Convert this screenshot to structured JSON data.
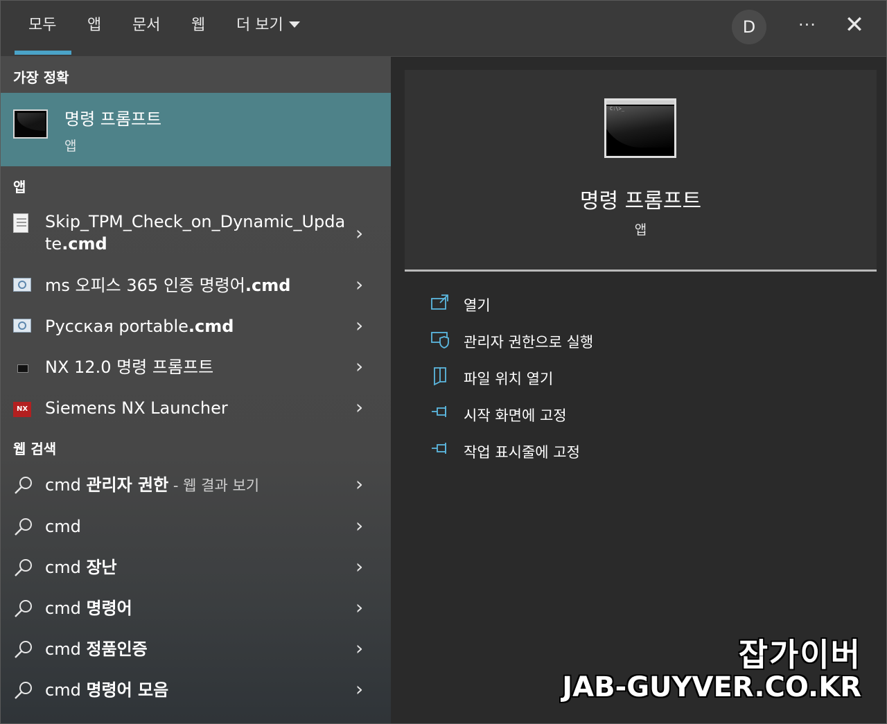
{
  "tabs": [
    {
      "label": "모두"
    },
    {
      "label": "앱"
    },
    {
      "label": "문서"
    },
    {
      "label": "웹"
    },
    {
      "label": "더 보기"
    }
  ],
  "account": {
    "initial": "D"
  },
  "more_label": "···",
  "close_label": "✕",
  "left": {
    "best_match_header": "가장 정확",
    "best_match": {
      "title": "명령 프롬프트",
      "subtitle": "앱"
    },
    "apps_header": "앱",
    "apps": [
      {
        "line1": "Skip_TPM_Check_on_Dynamic_Upda",
        "line2_pre": "te",
        "line2_bold": ".cmd",
        "icon": "document-icon"
      },
      {
        "text": "ms 오피스 365 인증 명령어",
        "bold": ".cmd",
        "icon": "settings-document-icon"
      },
      {
        "text": "Русская portable",
        "bold": ".cmd",
        "icon": "settings-document-icon"
      },
      {
        "text": "NX 12.0 명령 프롬프트",
        "icon": "command-prompt-icon"
      },
      {
        "text": "Siemens NX Launcher",
        "icon": "nx-logo-icon",
        "icon_text": "NX"
      }
    ],
    "web_header": "웹 검색",
    "web": [
      {
        "plain": "cmd ",
        "bold": "관리자 권한",
        "suffix": " - 웹 결과 보기"
      },
      {
        "plain": "cmd",
        "bold": ""
      },
      {
        "plain": "cmd ",
        "bold": "장난"
      },
      {
        "plain": "cmd ",
        "bold": "명령어"
      },
      {
        "plain": "cmd ",
        "bold": "정품인증"
      },
      {
        "plain": "cmd ",
        "bold": "명령어 모음"
      }
    ],
    "chevron": "›"
  },
  "right": {
    "title": "명령 프롬프트",
    "subtitle": "앱",
    "icon_prompt": "C:\\>_",
    "actions": [
      {
        "label": "열기",
        "icon": "open-icon"
      },
      {
        "label": "관리자 권한으로 실행",
        "icon": "shield-icon"
      },
      {
        "label": "파일 위치 열기",
        "icon": "file-location-icon"
      },
      {
        "label": "시작 화면에 고정",
        "icon": "pin-icon"
      },
      {
        "label": "작업 표시줄에 고정",
        "icon": "pin-icon"
      }
    ]
  },
  "watermark": {
    "line1": "잡가이버",
    "line2": "JAB-GUYVER.CO.KR"
  },
  "colors": {
    "accent": "#4aa3c8",
    "selected": "#4e8289"
  }
}
